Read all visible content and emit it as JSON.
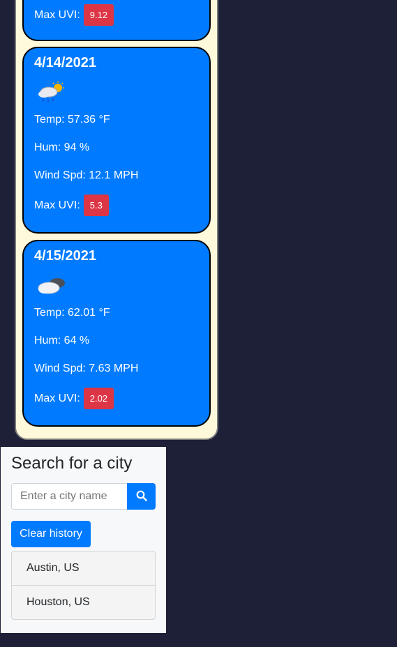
{
  "forecast": {
    "top_card": {
      "uvi_label": "Max UVI:",
      "uvi_value": "9.12"
    },
    "days": [
      {
        "date": "4/14/2021",
        "icon": "rain-sun-icon",
        "temp": "Temp: 57.36 °F",
        "hum": "Hum: 94 %",
        "wind": "Wind Spd: 12.1 MPH",
        "uvi_label": "Max UVI:",
        "uvi_value": "5.3"
      },
      {
        "date": "4/15/2021",
        "icon": "cloudy-icon",
        "temp": "Temp: 62.01 °F",
        "hum": "Hum: 64 %",
        "wind": "Wind Spd: 7.63 MPH",
        "uvi_label": "Max UVI:",
        "uvi_value": "2.02"
      }
    ],
    "colors": {
      "card": "#007bff",
      "panel": "#fff9dc",
      "uvi_badge": "#dc3545"
    }
  },
  "search": {
    "title": "Search for a city",
    "placeholder": "Enter a city name",
    "search_icon": "search-icon",
    "clear_label": "Clear history",
    "history": [
      "Austin, US",
      "Houston, US"
    ]
  },
  "colors": {
    "background": "#1e2038",
    "accent": "#007bff"
  }
}
